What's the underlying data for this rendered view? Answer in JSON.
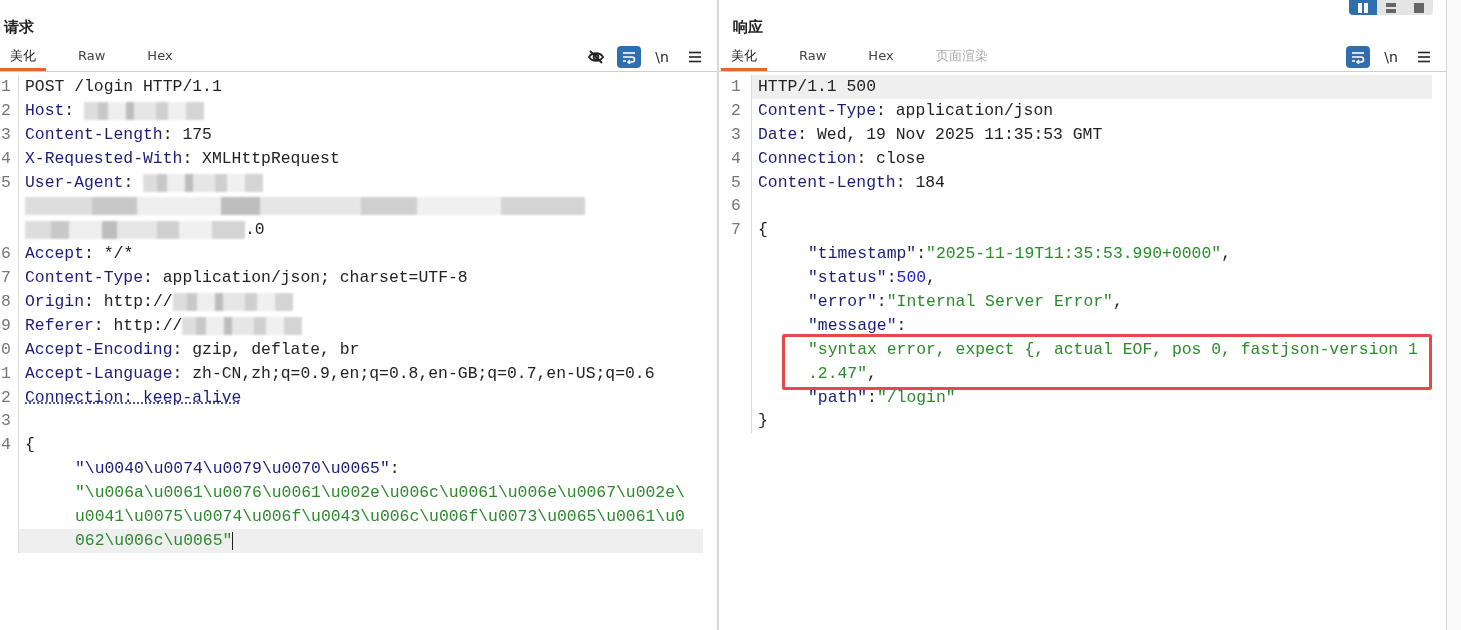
{
  "view_toggle": [
    {
      "kind": "columns",
      "selected": true
    },
    {
      "kind": "rows",
      "selected": false
    },
    {
      "kind": "single",
      "selected": false
    }
  ],
  "panes": [
    {
      "title": "请求",
      "tabs": [
        {
          "label": "美化",
          "selected": true,
          "disabled": false
        },
        {
          "label": "Raw",
          "selected": false,
          "disabled": false
        },
        {
          "label": "Hex",
          "selected": false,
          "disabled": false
        }
      ],
      "toolbar": [
        {
          "kind": "hide",
          "selected": false
        },
        {
          "kind": "wrap",
          "selected": true
        },
        {
          "kind": "newline",
          "text": "\\n",
          "selected": false
        },
        {
          "kind": "menu",
          "selected": false
        }
      ],
      "rows": [
        {
          "n": "1",
          "segs": [
            {
              "kind": "plain",
              "text": "POST /login HTTP/1.1"
            }
          ]
        },
        {
          "n": "2",
          "segs": [
            {
              "kind": "key",
              "text": "Host"
            },
            {
              "kind": "plain",
              "text": ": "
            },
            {
              "kind": "redacted"
            }
          ]
        },
        {
          "n": "3",
          "segs": [
            {
              "kind": "key",
              "text": "Content-Length"
            },
            {
              "kind": "plain",
              "text": ": 175"
            }
          ]
        },
        {
          "n": "4",
          "segs": [
            {
              "kind": "key",
              "text": "X-Requested-With"
            },
            {
              "kind": "plain",
              "text": ": XMLHttpRequest"
            }
          ]
        },
        {
          "n": "5",
          "segs": [
            {
              "kind": "key",
              "text": "User-Agent"
            },
            {
              "kind": "plain",
              "text": ": "
            },
            {
              "kind": "redacted"
            }
          ]
        },
        {
          "segs": [
            {
              "kind": "redacted"
            }
          ]
        },
        {
          "segs": [
            {
              "kind": "redacted"
            },
            {
              "kind": "plain",
              "text": ".0"
            }
          ]
        },
        {
          "n": "6",
          "segs": [
            {
              "kind": "key",
              "text": "Accept"
            },
            {
              "kind": "plain",
              "text": ": */*"
            }
          ]
        },
        {
          "n": "7",
          "segs": [
            {
              "kind": "key",
              "text": "Content-Type"
            },
            {
              "kind": "plain",
              "text": ": application/json; charset=UTF-8"
            }
          ]
        },
        {
          "n": "8",
          "segs": [
            {
              "kind": "key",
              "text": "Origin"
            },
            {
              "kind": "plain",
              "text": ": http://"
            },
            {
              "kind": "redacted"
            }
          ]
        },
        {
          "n": "9",
          "segs": [
            {
              "kind": "key",
              "text": "Referer"
            },
            {
              "kind": "plain",
              "text": ": http://"
            },
            {
              "kind": "redacted"
            }
          ]
        },
        {
          "n": "0",
          "segs": [
            {
              "kind": "key",
              "text": "Accept-Encoding"
            },
            {
              "kind": "plain",
              "text": ": gzip, deflate, br"
            }
          ]
        },
        {
          "n": "1",
          "segs": [
            {
              "kind": "key",
              "text": "Accept-Language"
            },
            {
              "kind": "plain",
              "text": ": zh-CN,zh;q=0.9,en;q=0.8,en-GB;q=0.7,en-US;q=0.6"
            }
          ]
        },
        {
          "n": "2",
          "segs": [
            {
              "kind": "key",
              "text": "Connection: keep-alive",
              "underline": true
            }
          ]
        },
        {
          "n": "3",
          "segs": []
        },
        {
          "n": "4",
          "segs": [
            {
              "kind": "plain",
              "text": "{"
            }
          ]
        },
        {
          "indent": true,
          "segs": [
            {
              "kind": "key",
              "text": "\"\\u0040\\u0074\\u0079\\u0070\\u0065\""
            },
            {
              "kind": "plain",
              "text": ":"
            }
          ]
        },
        {
          "indent": true,
          "segs": [
            {
              "kind": "string",
              "text": "\"\\u006a\\u0061\\u0076\\u0061\\u002e\\u006c\\u0061\\u006e\\u0067\\u002e\\"
            }
          ]
        },
        {
          "indent": true,
          "segs": [
            {
              "kind": "string",
              "text": "u0041\\u0075\\u0074\\u006f\\u0043\\u006c\\u006f\\u0073\\u0065\\u0061\\u0"
            }
          ]
        },
        {
          "indent": true,
          "current": true,
          "cursor": true,
          "segs": [
            {
              "kind": "string",
              "text": "062\\u006c\\u0065\""
            }
          ]
        }
      ]
    },
    {
      "title": "响应",
      "tabs": [
        {
          "label": "美化",
          "selected": true,
          "disabled": false
        },
        {
          "label": "Raw",
          "selected": false,
          "disabled": false
        },
        {
          "label": "Hex",
          "selected": false,
          "disabled": false
        },
        {
          "label": "页面渲染",
          "selected": false,
          "disabled": true
        }
      ],
      "toolbar": [
        {
          "kind": "wrap",
          "selected": true
        },
        {
          "kind": "newline",
          "text": "\\n",
          "selected": false
        },
        {
          "kind": "menu",
          "selected": false
        }
      ],
      "rows": [
        {
          "n": "1",
          "current": true,
          "segs": [
            {
              "kind": "plain",
              "text": "HTTP/1.1 500"
            }
          ]
        },
        {
          "n": "2",
          "segs": [
            {
              "kind": "key",
              "text": "Content-Type"
            },
            {
              "kind": "plain",
              "text": ": application/json"
            }
          ]
        },
        {
          "n": "3",
          "segs": [
            {
              "kind": "key",
              "text": "Date"
            },
            {
              "kind": "plain",
              "text": ": Wed, 19 Nov 2025 11:35:53 GMT"
            }
          ]
        },
        {
          "n": "4",
          "segs": [
            {
              "kind": "key",
              "text": "Connection"
            },
            {
              "kind": "plain",
              "text": ": close"
            }
          ]
        },
        {
          "n": "5",
          "segs": [
            {
              "kind": "key",
              "text": "Content-Length"
            },
            {
              "kind": "plain",
              "text": ": 184"
            }
          ]
        },
        {
          "n": "6",
          "segs": []
        },
        {
          "n": "7",
          "segs": [
            {
              "kind": "plain",
              "text": "{"
            }
          ]
        },
        {
          "indent": true,
          "segs": [
            {
              "kind": "key",
              "text": "\"timestamp\""
            },
            {
              "kind": "plain",
              "text": ":"
            },
            {
              "kind": "string",
              "text": "\"2025-11-19T11:35:53.990+0000\""
            },
            {
              "kind": "plain",
              "text": ","
            }
          ]
        },
        {
          "indent": true,
          "segs": [
            {
              "kind": "key",
              "text": "\"status\""
            },
            {
              "kind": "plain",
              "text": ":"
            },
            {
              "kind": "number",
              "text": "500"
            },
            {
              "kind": "plain",
              "text": ","
            }
          ]
        },
        {
          "indent": true,
          "segs": [
            {
              "kind": "key",
              "text": "\"error\""
            },
            {
              "kind": "plain",
              "text": ":"
            },
            {
              "kind": "string",
              "text": "\"Internal Server Error\""
            },
            {
              "kind": "plain",
              "text": ","
            }
          ]
        },
        {
          "indent": true,
          "segs": [
            {
              "kind": "key",
              "text": "\"message\""
            },
            {
              "kind": "plain",
              "text": ":"
            }
          ]
        },
        {
          "indent": true,
          "boxed": true,
          "segs": [
            {
              "kind": "string",
              "text": "\"syntax error, expect {, actual EOF, pos 0, fastjson-version 1"
            }
          ]
        },
        {
          "indent": true,
          "boxed": true,
          "segs": [
            {
              "kind": "string",
              "text": ".2.47\""
            },
            {
              "kind": "plain",
              "text": ","
            }
          ]
        },
        {
          "indent": true,
          "segs": [
            {
              "kind": "key",
              "text": "\"path\""
            },
            {
              "kind": "plain",
              "text": ":"
            },
            {
              "kind": "string",
              "text": "\"/login\""
            }
          ]
        },
        {
          "segs": [
            {
              "kind": "plain",
              "text": "}"
            }
          ]
        }
      ]
    }
  ]
}
